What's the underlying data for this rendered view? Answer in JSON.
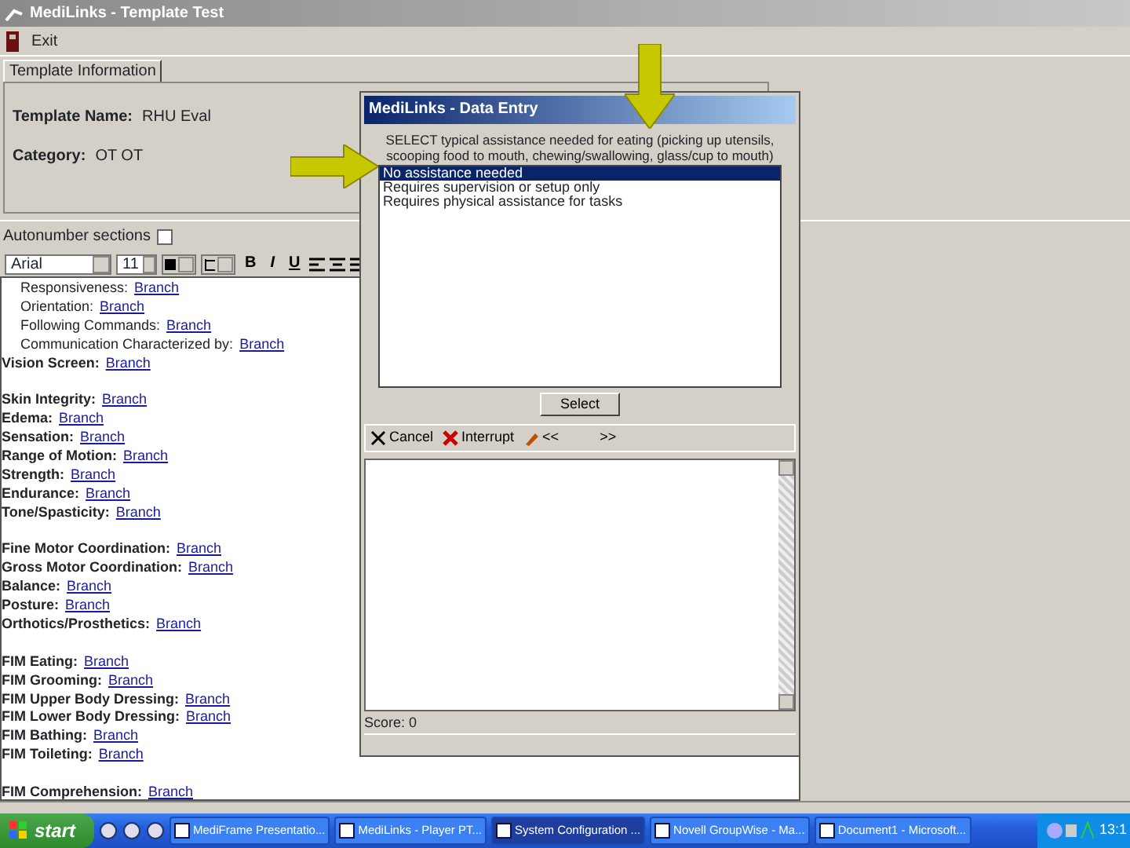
{
  "window": {
    "title": "MediLinks - Template Test"
  },
  "menu": [
    {
      "label": "Exit"
    }
  ],
  "tabs": [
    {
      "label": "Template Information",
      "selected": true
    }
  ],
  "template": {
    "fields": [
      {
        "label": "Template Name:",
        "value": "RHU Eval"
      },
      {
        "label": "Category:",
        "value": "OT OT"
      }
    ]
  },
  "autonumber": {
    "label": "Autonumber sections",
    "checked": false
  },
  "format_toolbar": {
    "font": "Arial",
    "size": "11",
    "buttons": [
      "B",
      "I",
      "U"
    ]
  },
  "editor": {
    "groups": [
      {
        "lines": [
          {
            "kind": "sub",
            "label": "Responsiveness:",
            "link": "Branch"
          },
          {
            "kind": "sub",
            "label": "Orientation:",
            "link": "Branch"
          },
          {
            "kind": "sub",
            "label": "Following Commands:",
            "link": "Branch"
          },
          {
            "kind": "sub",
            "label": "Communication Characterized by:",
            "link": "Branch"
          },
          {
            "kind": "field",
            "label": "Vision Screen:",
            "link": "Branch"
          }
        ]
      },
      {
        "lines": [
          {
            "kind": "field",
            "label": "Skin Integrity:",
            "link": "Branch"
          },
          {
            "kind": "field",
            "label": "Edema:",
            "link": "Branch"
          },
          {
            "kind": "field",
            "label": "Sensation:",
            "link": "Branch"
          },
          {
            "kind": "field",
            "label": "Range of Motion:",
            "link": "Branch"
          },
          {
            "kind": "field",
            "label": "Strength:",
            "link": "Branch"
          },
          {
            "kind": "field",
            "label": "Endurance:",
            "link": "Branch"
          },
          {
            "kind": "field",
            "label": "Tone/Spasticity:",
            "link": "Branch"
          }
        ]
      },
      {
        "lines": [
          {
            "kind": "field",
            "label": "Fine Motor Coordination:",
            "link": "Branch"
          },
          {
            "kind": "field",
            "label": "Gross Motor Coordination:",
            "link": "Branch"
          },
          {
            "kind": "field",
            "label": "Balance:",
            "link": "Branch"
          },
          {
            "kind": "field",
            "label": "Posture:",
            "link": "Branch"
          },
          {
            "kind": "field",
            "label": "Orthotics/Prosthetics:",
            "link": "Branch"
          }
        ]
      },
      {
        "lines": [
          {
            "kind": "field",
            "label": "FIM Eating:",
            "link": "Branch"
          },
          {
            "kind": "field",
            "label": "FIM Grooming:",
            "link": "Branch"
          },
          {
            "kind": "field",
            "label": "FIM Upper Body Dressing:",
            "link": "Branch"
          },
          {
            "kind": "field",
            "label": "FIM Lower Body Dressing:",
            "link": "Branch"
          },
          {
            "kind": "field",
            "label": "FIM Bathing:",
            "link": "Branch"
          },
          {
            "kind": "field",
            "label": "FIM Toileting:",
            "link": "Branch"
          }
        ]
      },
      {
        "lines": [
          {
            "kind": "field",
            "label": "FIM Comprehension:",
            "link": "Branch"
          }
        ]
      }
    ]
  },
  "dialog": {
    "title": "MediLinks - Data Entry",
    "prompt": "SELECT typical assistance needed for eating (picking up utensils, scooping food to mouth, chewing/swallowing, glass/cup to mouth)",
    "options": [
      {
        "label": "No assistance needed",
        "selected": true
      },
      {
        "label": "Requires supervision or setup only",
        "selected": false
      },
      {
        "label": "Requires physical assistance for tasks",
        "selected": false
      }
    ],
    "select_button": "Select",
    "toolbar": [
      {
        "kind": "cancel",
        "label": "Cancel"
      },
      {
        "kind": "interrupt",
        "label": "Interrupt"
      },
      {
        "kind": "back",
        "label": "<<"
      },
      {
        "kind": "next",
        "label": ">>"
      }
    ],
    "score": "Score: 0"
  },
  "taskbar": {
    "start": "start",
    "tasks": [
      {
        "label": "MediFrame Presentatio...",
        "selected": false
      },
      {
        "label": "MediLinks - Player PT...",
        "selected": false
      },
      {
        "label": "System Configuration ...",
        "selected": true
      },
      {
        "label": "Novell GroupWise - Ma...",
        "selected": false
      },
      {
        "label": "Document1 - Microsoft...",
        "selected": false
      }
    ],
    "clock": "13:1"
  }
}
